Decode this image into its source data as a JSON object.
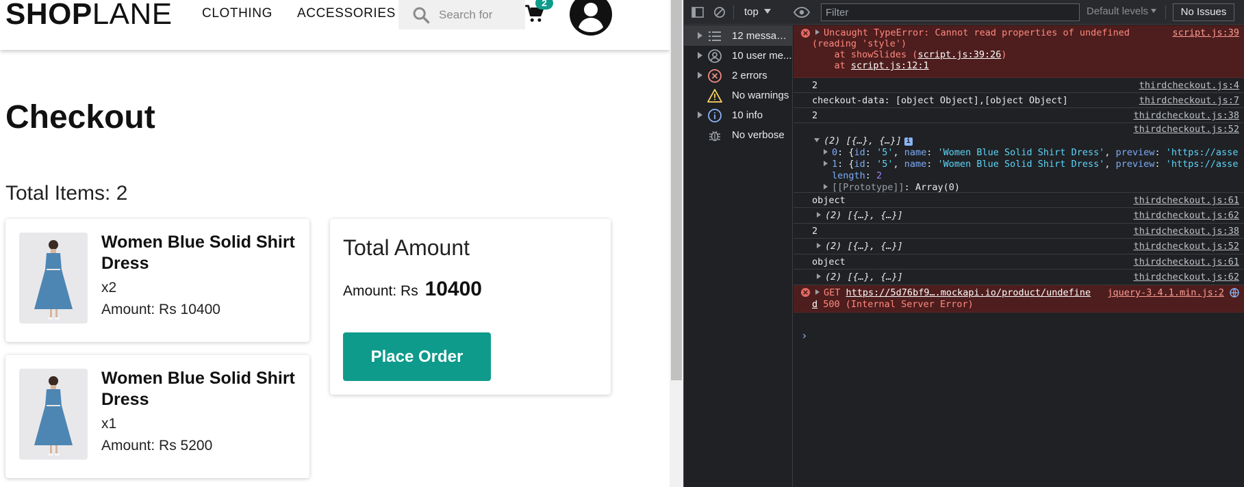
{
  "site": {
    "logo_bold": "SHOP",
    "logo_light": "LANE",
    "nav": [
      "CLOTHING",
      "ACCESSORIES"
    ],
    "search_placeholder": "Search for",
    "cart_count": "2"
  },
  "checkout": {
    "title": "Checkout",
    "total_items": "Total Items: 2",
    "items": [
      {
        "name": "Women Blue Solid Shirt Dress",
        "qty": "x2",
        "amount": "Amount: Rs 10400"
      },
      {
        "name": "Women Blue Solid Shirt Dress",
        "qty": "x1",
        "amount": "Amount: Rs 5200"
      }
    ],
    "total_title": "Total Amount",
    "amount_label": "Amount: Rs",
    "amount_value": "10400",
    "place_order": "Place Order"
  },
  "devtools": {
    "context": "top",
    "filter_placeholder": "Filter",
    "levels": "Default levels",
    "issues": "No Issues",
    "sidebar": [
      {
        "label": "12 messages",
        "icon": "list-icon"
      },
      {
        "label": "10 user me...",
        "icon": "user-icon"
      },
      {
        "label": "2 errors",
        "icon": "error-icon"
      },
      {
        "label": "No warnings",
        "icon": "warning-icon"
      },
      {
        "label": "10 info",
        "icon": "info-icon"
      },
      {
        "label": "No verbose",
        "icon": "bug-icon"
      }
    ],
    "console": {
      "err1_line1": "Uncaught TypeError: Cannot read properties of undefined",
      "err1_line2": "(reading 'style')",
      "err1_at1_pre": "    at showSlides (",
      "err1_at1_link": "script.js:39:26",
      "err1_at1_post": ")",
      "err1_at2_pre": "    at ",
      "err1_at2_link": "script.js:12:1",
      "err1_src": "script.js:39",
      "m1_text": "2",
      "m1_src": "thirdcheckout.js:4",
      "m2_text": "checkout-data: [object Object],[object Object]",
      "m2_src": "thirdcheckout.js:7",
      "m3_text": "2",
      "m3_src": "thirdcheckout.js:38",
      "m4_src": "thirdcheckout.js:52",
      "arr_summary": "(2) [{…}, {…}]",
      "row0_idx": "0",
      "row1_idx": "1",
      "row_id": "'5'",
      "row_name": "'Women Blue Solid Shirt Dress'",
      "row_preview": "'https://asse",
      "length_key": "length",
      "length_val": "2",
      "proto_key": "[[Prototype]]",
      "proto_val": "Array(0)",
      "m5_text": "object",
      "m5_src": "thirdcheckout.js:61",
      "m6_src": "thirdcheckout.js:62",
      "m7_text": "2",
      "m7_src": "thirdcheckout.js:38",
      "m8_src": "thirdcheckout.js:52",
      "m9_text": "object",
      "m9_src": "thirdcheckout.js:61",
      "m10_src": "thirdcheckout.js:62",
      "err2_method": "GET",
      "err2_url": "https://5d76bf9….mockapi.io/product/undefine",
      "err2_url_end": "d",
      "err2_status": "500 (Internal Server Error)",
      "err2_src": "jquery-3.4.1.min.js:2"
    }
  },
  "colors": {
    "accent": "#0f9b8b",
    "devtools_bg": "#202124",
    "error_bg": "#4e1d1d",
    "error_text": "#ff8a80"
  }
}
